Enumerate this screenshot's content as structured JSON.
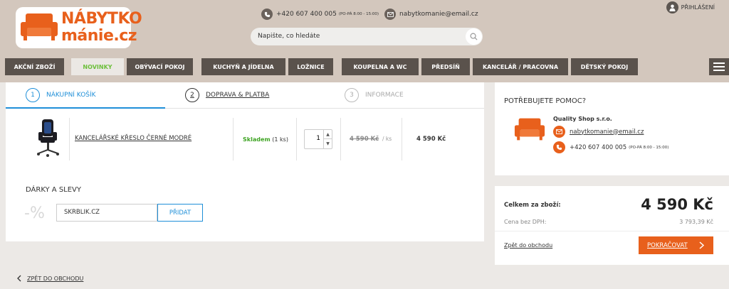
{
  "logo": {
    "line1": "NÁBYTKO",
    "line2": "mánie.cz",
    "icon": "sofa-icon"
  },
  "header": {
    "phone": "+420 607 400 005",
    "phone_hours": "(PO-PÁ 8:00 - 15:00)",
    "email": "nabytkomanie@email.cz",
    "login": "PŘIHLÁŠENÍ",
    "search_placeholder": "Napište, co hledáte"
  },
  "nav": [
    {
      "label": "AKČNÍ ZBOŽÍ"
    },
    {
      "label": "NOVINKY",
      "active": true
    },
    {
      "label": "OBÝVACÍ POKOJ"
    },
    {
      "label": "KUCHYŇ A JÍDELNA"
    },
    {
      "label": "LOŽNICE"
    },
    {
      "label": "KOUPELNA A WC"
    },
    {
      "label": "PŘEDSÍŇ"
    },
    {
      "label": "KANCELÁŘ / PRACOVNA"
    },
    {
      "label": "DĚTSKÝ POKOJ"
    }
  ],
  "steps": [
    {
      "num": "1",
      "label": "NÁKUPNÍ KOŠÍK"
    },
    {
      "num": "2",
      "label": "DOPRAVA & PLATBA"
    },
    {
      "num": "3",
      "label": "INFORMACE"
    }
  ],
  "cart": {
    "product_name": "KANCELÁŘSKÉ KŘESLO ČERNÉ MODRÉ",
    "stock_status": "Skladem",
    "stock_count": "(1 ks)",
    "quantity": "1",
    "unit_price": "4 590 Kč",
    "unit_suffix": "/ ks",
    "total_price": "4 590 Kč"
  },
  "gifts": {
    "title": "DÁRKY A SLEVY",
    "percent_symbol": "-%",
    "coupon_value": "SKRBLÍK.CZ",
    "add_button": "PŘIDAT"
  },
  "help": {
    "title": "POTŘEBUJETE POMOC?",
    "company": "Quality Shop s.r.o.",
    "email": "nabytkomanie@email.cz",
    "phone": "+420 607 400 005",
    "phone_hours": "(PO-PÁ 8:00 - 15:00)"
  },
  "summary": {
    "total_label": "Celkem za zboží:",
    "total_value": "4 590 Kč",
    "vat_label": "Cena bez DPH:",
    "vat_value": "3 793,39 Kč",
    "back_to_shop": "Zpět do obchodu",
    "continue": "POKRAČOVAT"
  },
  "footer": {
    "back_link": "ZPĚT DO OBCHODU"
  },
  "colors": {
    "accent_orange": "#e8601c",
    "accent_blue": "#1f8fd8",
    "nav_dark": "#5a524c",
    "header_bg": "#d3c7bd",
    "stock_green": "#3fa424"
  }
}
